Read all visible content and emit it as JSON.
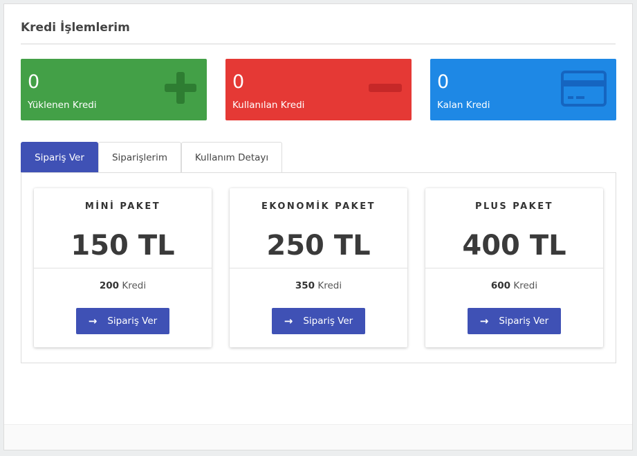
{
  "page": {
    "title": "Kredi İşlemlerim"
  },
  "stats": [
    {
      "value": "0",
      "label": "Yüklenen Kredi",
      "icon": "plus-icon",
      "color": "#43a047"
    },
    {
      "value": "0",
      "label": "Kullanılan Kredi",
      "icon": "minus-icon",
      "color": "#e53935"
    },
    {
      "value": "0",
      "label": "Kalan Kredi",
      "icon": "credit-card-icon",
      "color": "#1e88e5"
    }
  ],
  "tabs": [
    {
      "label": "Sipariş Ver",
      "active": true
    },
    {
      "label": "Siparişlerim",
      "active": false
    },
    {
      "label": "Kullanım Detayı",
      "active": false
    }
  ],
  "packages": [
    {
      "name": "MİNİ PAKET",
      "price": "150 TL",
      "credit_amount": "200",
      "credit_unit": "Kredi",
      "button_label": "Sipariş Ver"
    },
    {
      "name": "EKONOMİK PAKET",
      "price": "250 TL",
      "credit_amount": "350",
      "credit_unit": "Kredi",
      "button_label": "Sipariş Ver"
    },
    {
      "name": "PLUS PAKET",
      "price": "400 TL",
      "credit_amount": "600",
      "credit_unit": "Kredi",
      "button_label": "Sipariş Ver"
    }
  ],
  "colors": {
    "primary": "#3f51b5",
    "success": "#43a047",
    "danger": "#e53935",
    "info": "#1e88e5"
  }
}
